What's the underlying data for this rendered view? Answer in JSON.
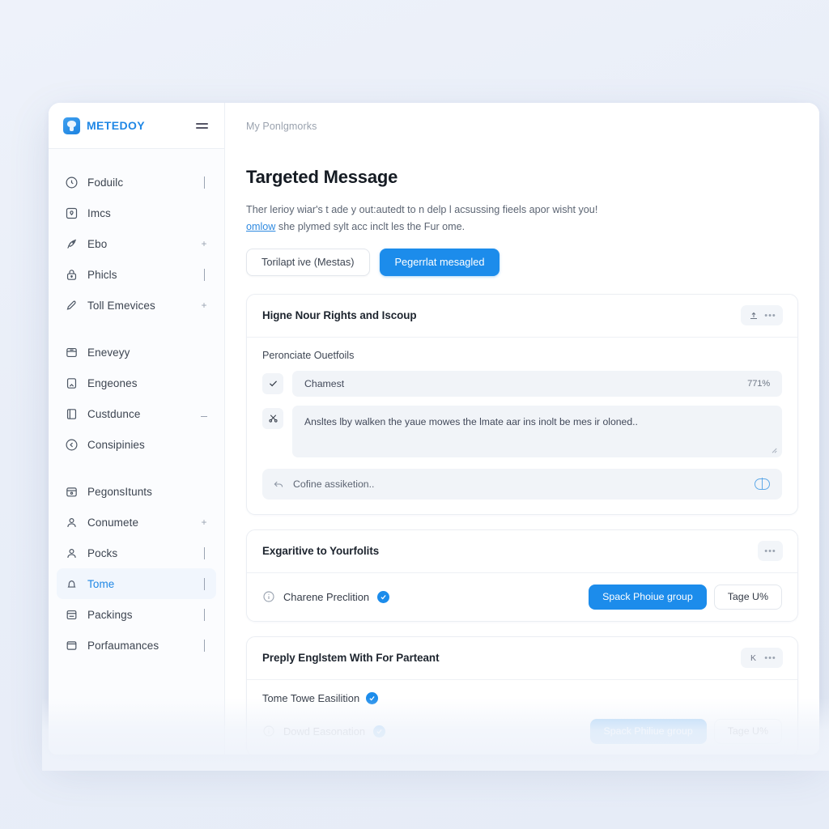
{
  "brand": {
    "name": "METEDOY",
    "logo_color": "#1f87e5",
    "menu_icon": "hamburger-icon"
  },
  "sidebar": {
    "groups": [
      {
        "items": [
          {
            "label": "Foduilc",
            "icon": "clock-icon",
            "affordance": "chevron",
            "active": false
          },
          {
            "label": "Imcs",
            "icon": "pin-square-icon",
            "affordance": "none",
            "active": false
          },
          {
            "label": "Ebo",
            "icon": "rocket-icon",
            "affordance": "plus",
            "active": false
          },
          {
            "label": "Phicls",
            "icon": "lock-icon",
            "affordance": "chevron",
            "active": false
          },
          {
            "label": "Toll Emevices",
            "icon": "pen-icon",
            "affordance": "plus",
            "active": false
          }
        ]
      },
      {
        "items": [
          {
            "label": "Eneveyy",
            "icon": "inbox-icon",
            "affordance": "none",
            "active": false
          },
          {
            "label": "Engeones",
            "icon": "bookmark-icon",
            "affordance": "none",
            "active": false
          },
          {
            "label": "Custdunce",
            "icon": "frame-icon",
            "affordance": "dash",
            "active": false
          },
          {
            "label": "Consipinies",
            "icon": "back-circle-icon",
            "affordance": "none",
            "active": false
          }
        ]
      },
      {
        "items": [
          {
            "label": "PegonsItunts",
            "icon": "calendar-icon",
            "affordance": "none",
            "active": false
          },
          {
            "label": "Conumete",
            "icon": "user-icon",
            "affordance": "plus",
            "active": false
          },
          {
            "label": "Pocks",
            "icon": "user-icon",
            "affordance": "chevron",
            "active": false
          },
          {
            "label": "Tome",
            "icon": "bell-icon",
            "affordance": "chevron",
            "active": true
          },
          {
            "label": "Packings",
            "icon": "list-card-icon",
            "affordance": "chevron",
            "active": false
          },
          {
            "label": "Porfaumances",
            "icon": "window-icon",
            "affordance": "chevron",
            "active": false
          }
        ]
      }
    ]
  },
  "topbar": {
    "breadcrumb": "My Ponlgmorks"
  },
  "page": {
    "title": "Targeted Message",
    "description_line1": "Ther lerioy wiar's t ade y out:autedt to n delp l acsussing fieels apor wisht you!",
    "description_link": "omlow",
    "description_line2": " she plymed sylt acc inclt les the Fur ome.",
    "actions": {
      "secondary_label": "Torilapt ivе (Mestas)",
      "primary_label": "Pegerrlat mesagled",
      "primary_color": "#1c8ceb"
    }
  },
  "cards": [
    {
      "title": "Higne Nour Rights and Iscoup",
      "tools": [
        "upload-icon",
        "more-icon"
      ],
      "section_label": "Peronciate Ouetfoils",
      "rows": [
        {
          "badge_icon": "check-icon",
          "type": "pill",
          "text": "Chamest",
          "value": "771%"
        },
        {
          "badge_icon": "scissors-icon",
          "type": "box",
          "text": "Ansltes lby walken the yaue mowes the lmate aar ins inolt be mes ir oloned.."
        }
      ],
      "composer": {
        "lead_icon": "reply-icon",
        "placeholder": "Cofine assiketion..",
        "toggle_icon": "toggle-icon"
      }
    },
    {
      "title": "Exgaritive to Yourfolits",
      "tools": [
        "more-icon"
      ],
      "row": {
        "info_icon": "info-icon",
        "label": "Charene Preclition",
        "verified": true,
        "primary_label": "Spack Phoiue group",
        "ghost_label": "Tage U%"
      }
    },
    {
      "title": "Preply Englstem With For Parteant",
      "tools": [
        "kbd-k-icon",
        "more-icon"
      ],
      "kbd_label": "K",
      "sub_label": "Tome Towe Easilition",
      "sub_verified": true,
      "ghost_row": {
        "label": "Dowd Easonation",
        "primary_label": "Spack Philiue group",
        "ghost_label": "Tage U%"
      }
    }
  ]
}
